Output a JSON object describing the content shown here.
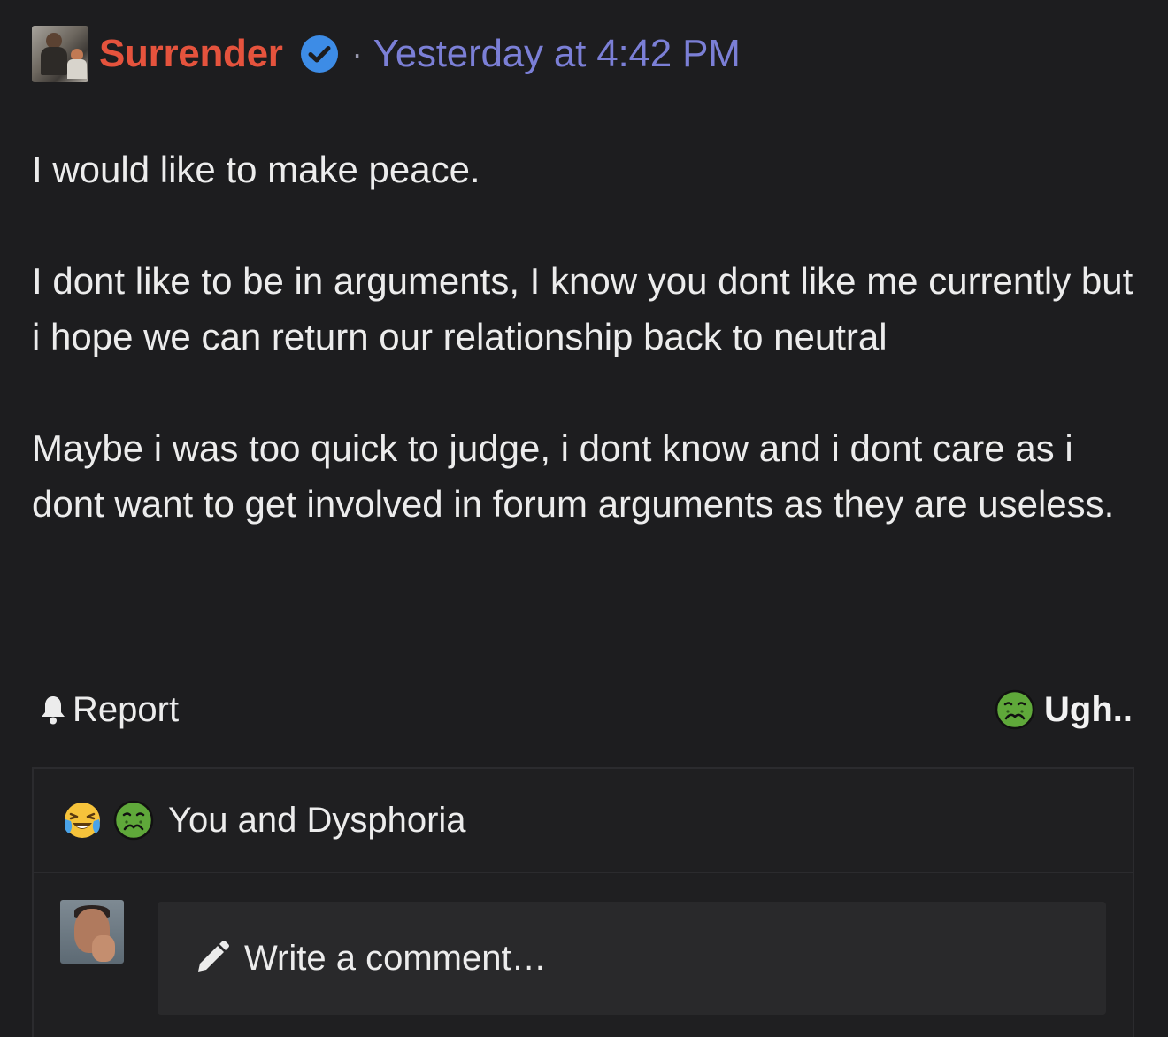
{
  "post": {
    "author": "Surrender",
    "verified_icon": "verified-check-icon",
    "separator": "·",
    "timestamp": "Yesterday at 4:42 PM",
    "paragraphs": [
      "I would like to make peace.",
      "I dont like to be in arguments, I know you dont like me currently but i hope we can return our relationship back to neutral",
      "Maybe i was too quick to judge, i dont know and i dont care as i dont want to get involved in forum arguments as they are useless."
    ]
  },
  "actions": {
    "report_label": "Report",
    "report_icon": "bell-icon",
    "reaction_label": "Ugh..",
    "reaction_icon": "nauseated-face-icon"
  },
  "reactions": {
    "icons": [
      "loudly-crying-laughing-icon",
      "nauseated-face-icon"
    ],
    "users_text": "You and Dysphoria"
  },
  "comment": {
    "placeholder": "Write a comment…",
    "icon": "pencil-icon"
  },
  "colors": {
    "background": "#1d1d1f",
    "username": "#e5533d",
    "timestamp": "#7b7fd6",
    "verified": "#3d8ce6"
  }
}
